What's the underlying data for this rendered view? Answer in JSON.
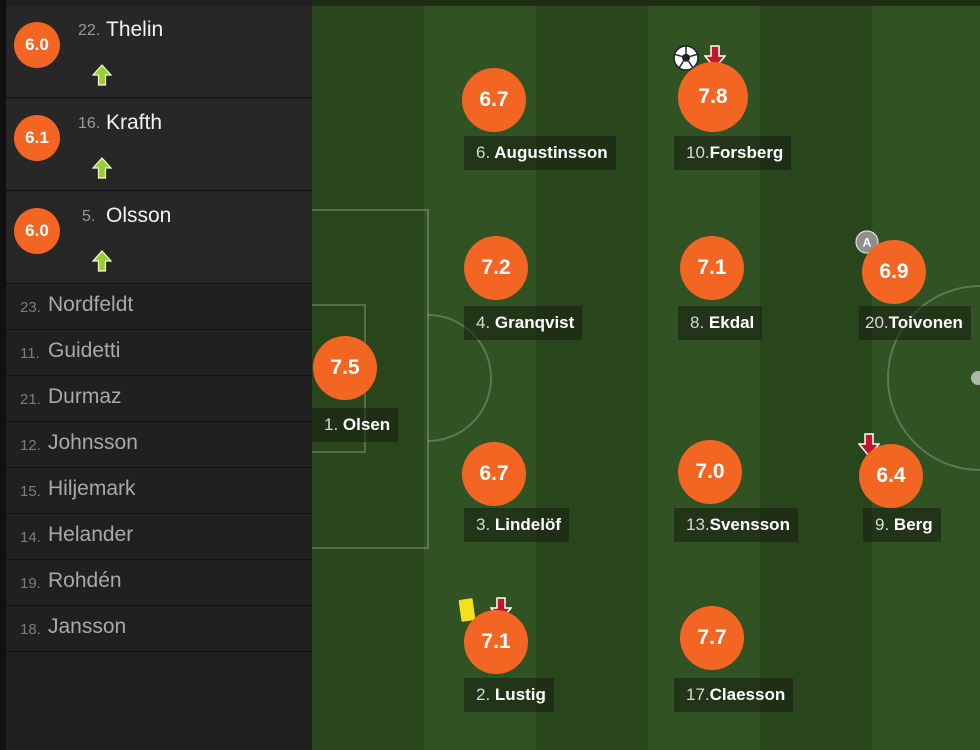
{
  "colors": {
    "rating_badge": "#f26522",
    "sub_in_arrow": "#9acd32",
    "sub_out_arrow": "#c0182a",
    "yellow_card": "#f5e11a",
    "pitch_dark": "#29451b",
    "pitch_light": "#315222"
  },
  "substitutes_in": [
    {
      "rating": "6.0",
      "number": "22.",
      "name": "Thelin",
      "icon": "sub-in-arrow-icon"
    },
    {
      "rating": "6.1",
      "number": "16.",
      "name": "Krafth",
      "icon": "sub-in-arrow-icon"
    },
    {
      "rating": "6.0",
      "number": "5.",
      "name": "Olsson",
      "icon": "sub-in-arrow-icon"
    }
  ],
  "bench": [
    {
      "number": "23.",
      "name": "Nordfeldt"
    },
    {
      "number": "11.",
      "name": "Guidetti"
    },
    {
      "number": "21.",
      "name": "Durmaz"
    },
    {
      "number": "12.",
      "name": "Johnsson"
    },
    {
      "number": "15.",
      "name": "Hiljemark"
    },
    {
      "number": "14.",
      "name": "Helander"
    },
    {
      "number": "19.",
      "name": "Rohdén"
    },
    {
      "number": "18.",
      "name": "Jansson"
    }
  ],
  "lineup": [
    {
      "number": "1.",
      "name": "Olsen",
      "rating": "7.5",
      "icons": []
    },
    {
      "number": "6.",
      "name": "Augustinsson",
      "rating": "6.7",
      "icons": []
    },
    {
      "number": "4.",
      "name": "Granqvist",
      "rating": "7.2",
      "icons": []
    },
    {
      "number": "3.",
      "name": "Lindelöf",
      "rating": "6.7",
      "icons": []
    },
    {
      "number": "2.",
      "name": "Lustig",
      "rating": "7.1",
      "icons": [
        "yellow-card-icon",
        "sub-out-arrow-icon"
      ]
    },
    {
      "number": "10.",
      "name": "Forsberg",
      "rating": "7.8",
      "icons": [
        "goal-ball-icon",
        "sub-out-arrow-icon"
      ]
    },
    {
      "number": "8.",
      "name": "Ekdal",
      "rating": "7.1",
      "icons": []
    },
    {
      "number": "13.",
      "name": "Svensson",
      "rating": "7.0",
      "icons": []
    },
    {
      "number": "17.",
      "name": "Claesson",
      "rating": "7.7",
      "icons": []
    },
    {
      "number": "20.",
      "name": "Toivonen",
      "rating": "6.9",
      "icons": [
        "assist-badge-icon"
      ],
      "assist_letter": "A"
    },
    {
      "number": "9.",
      "name": "Berg",
      "rating": "6.4",
      "icons": [
        "sub-out-arrow-icon"
      ]
    }
  ]
}
